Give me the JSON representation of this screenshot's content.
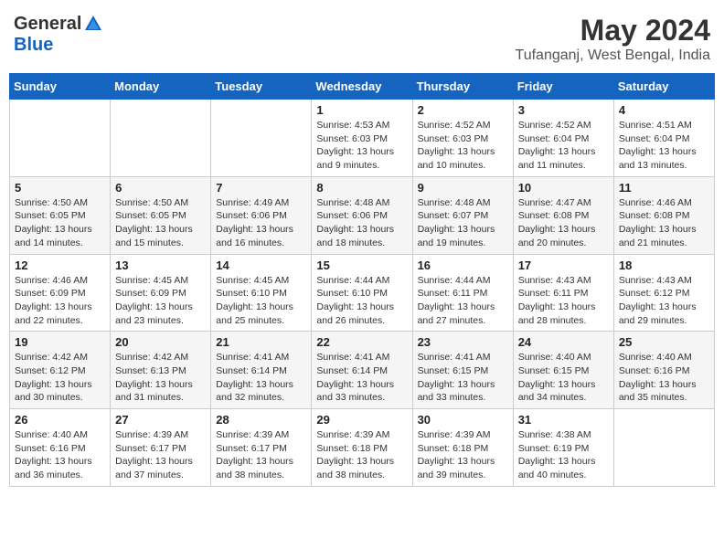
{
  "logo": {
    "general": "General",
    "blue": "Blue"
  },
  "title": "May 2024",
  "subtitle": "Tufanganj, West Bengal, India",
  "days_of_week": [
    "Sunday",
    "Monday",
    "Tuesday",
    "Wednesday",
    "Thursday",
    "Friday",
    "Saturday"
  ],
  "weeks": [
    [
      {
        "day": "",
        "sunrise": "",
        "sunset": "",
        "daylight": ""
      },
      {
        "day": "",
        "sunrise": "",
        "sunset": "",
        "daylight": ""
      },
      {
        "day": "",
        "sunrise": "",
        "sunset": "",
        "daylight": ""
      },
      {
        "day": "1",
        "sunrise": "4:53 AM",
        "sunset": "6:03 PM",
        "daylight": "13 hours and 9 minutes."
      },
      {
        "day": "2",
        "sunrise": "4:52 AM",
        "sunset": "6:03 PM",
        "daylight": "13 hours and 10 minutes."
      },
      {
        "day": "3",
        "sunrise": "4:52 AM",
        "sunset": "6:04 PM",
        "daylight": "13 hours and 11 minutes."
      },
      {
        "day": "4",
        "sunrise": "4:51 AM",
        "sunset": "6:04 PM",
        "daylight": "13 hours and 13 minutes."
      }
    ],
    [
      {
        "day": "5",
        "sunrise": "4:50 AM",
        "sunset": "6:05 PM",
        "daylight": "13 hours and 14 minutes."
      },
      {
        "day": "6",
        "sunrise": "4:50 AM",
        "sunset": "6:05 PM",
        "daylight": "13 hours and 15 minutes."
      },
      {
        "day": "7",
        "sunrise": "4:49 AM",
        "sunset": "6:06 PM",
        "daylight": "13 hours and 16 minutes."
      },
      {
        "day": "8",
        "sunrise": "4:48 AM",
        "sunset": "6:06 PM",
        "daylight": "13 hours and 18 minutes."
      },
      {
        "day": "9",
        "sunrise": "4:48 AM",
        "sunset": "6:07 PM",
        "daylight": "13 hours and 19 minutes."
      },
      {
        "day": "10",
        "sunrise": "4:47 AM",
        "sunset": "6:08 PM",
        "daylight": "13 hours and 20 minutes."
      },
      {
        "day": "11",
        "sunrise": "4:46 AM",
        "sunset": "6:08 PM",
        "daylight": "13 hours and 21 minutes."
      }
    ],
    [
      {
        "day": "12",
        "sunrise": "4:46 AM",
        "sunset": "6:09 PM",
        "daylight": "13 hours and 22 minutes."
      },
      {
        "day": "13",
        "sunrise": "4:45 AM",
        "sunset": "6:09 PM",
        "daylight": "13 hours and 23 minutes."
      },
      {
        "day": "14",
        "sunrise": "4:45 AM",
        "sunset": "6:10 PM",
        "daylight": "13 hours and 25 minutes."
      },
      {
        "day": "15",
        "sunrise": "4:44 AM",
        "sunset": "6:10 PM",
        "daylight": "13 hours and 26 minutes."
      },
      {
        "day": "16",
        "sunrise": "4:44 AM",
        "sunset": "6:11 PM",
        "daylight": "13 hours and 27 minutes."
      },
      {
        "day": "17",
        "sunrise": "4:43 AM",
        "sunset": "6:11 PM",
        "daylight": "13 hours and 28 minutes."
      },
      {
        "day": "18",
        "sunrise": "4:43 AM",
        "sunset": "6:12 PM",
        "daylight": "13 hours and 29 minutes."
      }
    ],
    [
      {
        "day": "19",
        "sunrise": "4:42 AM",
        "sunset": "6:12 PM",
        "daylight": "13 hours and 30 minutes."
      },
      {
        "day": "20",
        "sunrise": "4:42 AM",
        "sunset": "6:13 PM",
        "daylight": "13 hours and 31 minutes."
      },
      {
        "day": "21",
        "sunrise": "4:41 AM",
        "sunset": "6:14 PM",
        "daylight": "13 hours and 32 minutes."
      },
      {
        "day": "22",
        "sunrise": "4:41 AM",
        "sunset": "6:14 PM",
        "daylight": "13 hours and 33 minutes."
      },
      {
        "day": "23",
        "sunrise": "4:41 AM",
        "sunset": "6:15 PM",
        "daylight": "13 hours and 33 minutes."
      },
      {
        "day": "24",
        "sunrise": "4:40 AM",
        "sunset": "6:15 PM",
        "daylight": "13 hours and 34 minutes."
      },
      {
        "day": "25",
        "sunrise": "4:40 AM",
        "sunset": "6:16 PM",
        "daylight": "13 hours and 35 minutes."
      }
    ],
    [
      {
        "day": "26",
        "sunrise": "4:40 AM",
        "sunset": "6:16 PM",
        "daylight": "13 hours and 36 minutes."
      },
      {
        "day": "27",
        "sunrise": "4:39 AM",
        "sunset": "6:17 PM",
        "daylight": "13 hours and 37 minutes."
      },
      {
        "day": "28",
        "sunrise": "4:39 AM",
        "sunset": "6:17 PM",
        "daylight": "13 hours and 38 minutes."
      },
      {
        "day": "29",
        "sunrise": "4:39 AM",
        "sunset": "6:18 PM",
        "daylight": "13 hours and 38 minutes."
      },
      {
        "day": "30",
        "sunrise": "4:39 AM",
        "sunset": "6:18 PM",
        "daylight": "13 hours and 39 minutes."
      },
      {
        "day": "31",
        "sunrise": "4:38 AM",
        "sunset": "6:19 PM",
        "daylight": "13 hours and 40 minutes."
      },
      {
        "day": "",
        "sunrise": "",
        "sunset": "",
        "daylight": ""
      }
    ]
  ],
  "labels": {
    "sunrise": "Sunrise:",
    "sunset": "Sunset:",
    "daylight": "Daylight:"
  }
}
